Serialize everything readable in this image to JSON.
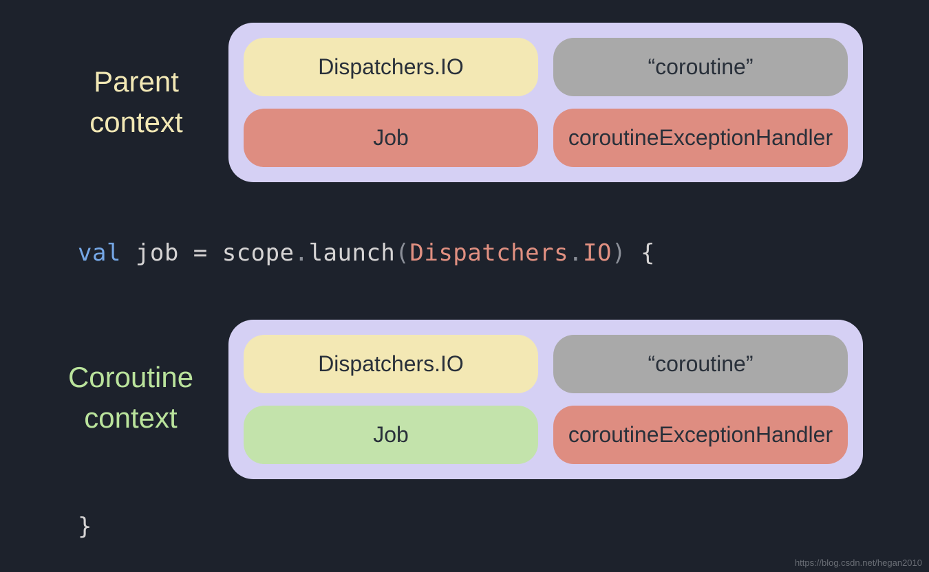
{
  "labels": {
    "parent_line1": "Parent",
    "parent_line2": "context",
    "coroutine_line1": "Coroutine",
    "coroutine_line2": "context"
  },
  "parent_box": {
    "dispatcher": "Dispatchers.IO",
    "name": "“coroutine”",
    "job": "Job",
    "handler": "coroutineExceptionHandler"
  },
  "coroutine_box": {
    "dispatcher": "Dispatchers.IO",
    "name": "“coroutine”",
    "job": "Job",
    "handler": "coroutineExceptionHandler"
  },
  "code": {
    "keyword": "val",
    "ident": " job ",
    "eq": "=",
    "scope": " scope",
    "dot1": ".",
    "launch": "launch",
    "paren_open": "(",
    "disp_left": "Dispatchers",
    "dot2": ".",
    "disp_right": "IO",
    "paren_close": ")",
    "brace_open": " {",
    "brace_close": "}"
  },
  "watermark": "https://blog.csdn.net/hegan2010"
}
